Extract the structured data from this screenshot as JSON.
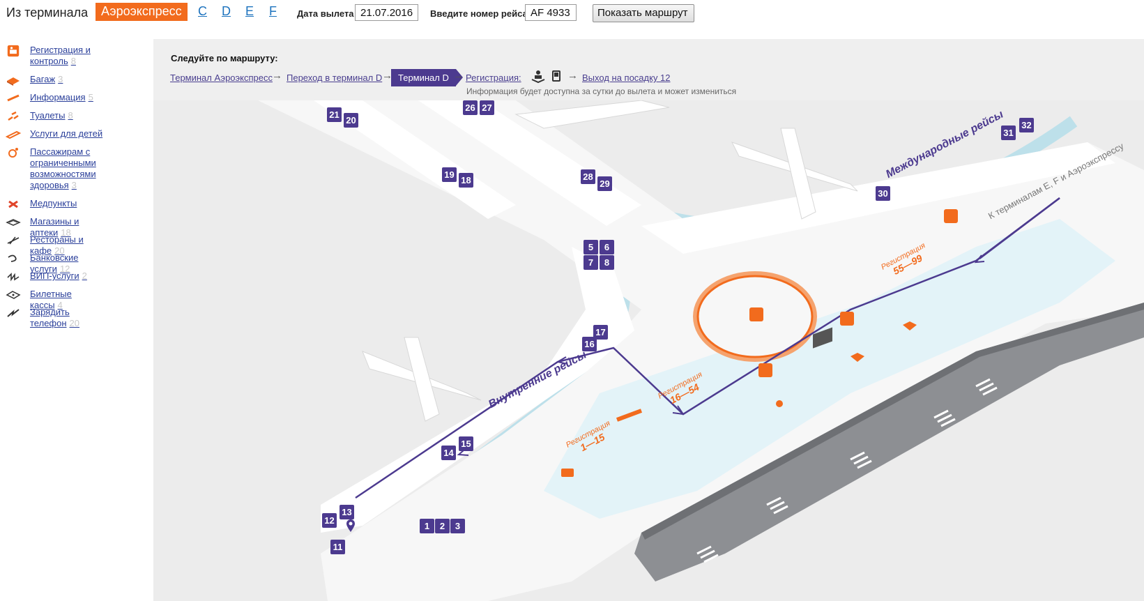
{
  "header": {
    "from_label": "Из терминала",
    "terminals": [
      "Аэроэкспресс",
      "C",
      "D",
      "E",
      "F"
    ],
    "active_terminal": "Аэроэкспресс",
    "date_label": "Дата вылета",
    "date_value": "21.07.2016",
    "flight_label": "Введите номер рейса",
    "flight_value": "AF 4933",
    "show_route_button": "Показать маршрут"
  },
  "sidebar": {
    "items": [
      {
        "label": "Регистрация и контроль",
        "count": "8",
        "icon": "checkin-icon"
      },
      {
        "label": "Багаж",
        "count": "3",
        "icon": "baggage-icon"
      },
      {
        "label": "Информация",
        "count": "5",
        "icon": "info-icon"
      },
      {
        "label": "Туалеты",
        "count": "8",
        "icon": "toilet-icon"
      },
      {
        "label": "Услуги для детей",
        "count": "",
        "icon": "children-icon"
      },
      {
        "label": "Пассажирам с ограниченными возможностями здоровья",
        "count": "3",
        "icon": "accessibility-icon"
      },
      {
        "label": "Медпункты",
        "count": "",
        "icon": "medical-icon"
      },
      {
        "label": "Магазины и аптеки",
        "count": "18",
        "icon": "shop-icon"
      },
      {
        "label": "Рестораны и кафе",
        "count": "20",
        "icon": "restaurant-icon"
      },
      {
        "label": "Банковские услуги",
        "count": "12",
        "icon": "bank-icon"
      },
      {
        "label": "ВИП-услуги",
        "count": "2",
        "icon": "vip-icon"
      },
      {
        "label": "Билетные кассы",
        "count": "4",
        "icon": "ticket-icon"
      },
      {
        "label": "Зарядить телефон",
        "count": "20",
        "icon": "charge-icon"
      }
    ]
  },
  "route": {
    "title": "Следуйте по маршруту:",
    "steps": [
      "Терминал Аэроэкспресс",
      "Переход в терминал D",
      "Терминал D",
      "Регистрация:",
      "Выход на посадку 12"
    ],
    "active_step": "Терминал D",
    "note": "Информация будет доступна за сутки до вылета и может измениться"
  },
  "map": {
    "gates": [
      "21",
      "20",
      "26",
      "27",
      "19",
      "18",
      "28",
      "29",
      "31",
      "32",
      "30",
      "5",
      "6",
      "7",
      "8",
      "17",
      "16",
      "14",
      "15",
      "12",
      "13",
      "11",
      "1",
      "2",
      "3"
    ],
    "labels": {
      "international": "Международные рейсы",
      "domestic": "Внутренние рейсы",
      "to_terminals": "К терминалам E, F и Аэроэкспрессу",
      "reg_55_99_title": "Регистрация",
      "reg_55_99_range": "55—99",
      "reg_16_54_title": "Регистрация",
      "reg_16_54_range": "16—54",
      "reg_1_15_title": "Регистрация",
      "reg_1_15_range": "1—15"
    },
    "colors": {
      "route": "#4c3a8f",
      "accent": "#f26b1d",
      "water": "#bde0ea",
      "tarmac": "#8d8f93"
    }
  }
}
